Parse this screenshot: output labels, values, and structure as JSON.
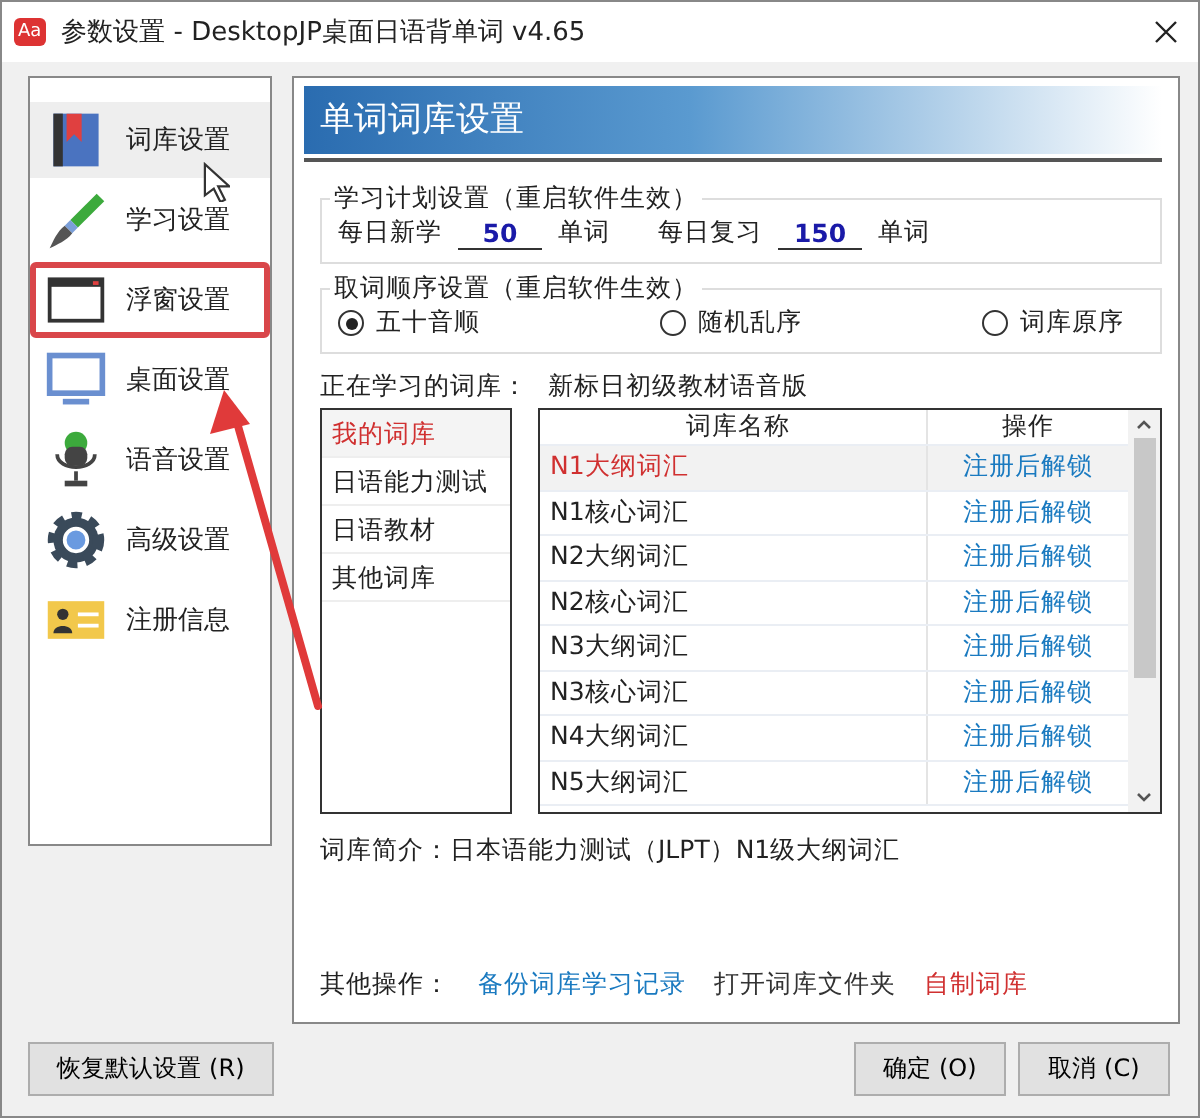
{
  "window": {
    "title": "参数设置 - DesktopJP桌面日语背单词 v4.65",
    "app_icon": "Aa"
  },
  "sidebar": {
    "items": [
      {
        "label": "词库设置",
        "selected": true,
        "highlighted": false
      },
      {
        "label": "学习设置",
        "selected": false,
        "highlighted": false
      },
      {
        "label": "浮窗设置",
        "selected": false,
        "highlighted": true
      },
      {
        "label": "桌面设置",
        "selected": false,
        "highlighted": false
      },
      {
        "label": "语音设置",
        "selected": false,
        "highlighted": false
      },
      {
        "label": "高级设置",
        "selected": false,
        "highlighted": false
      },
      {
        "label": "注册信息",
        "selected": false,
        "highlighted": false
      }
    ]
  },
  "panel": {
    "title": "单词词库设置",
    "plan": {
      "legend": "学习计划设置（重启软件生效）",
      "new_label": "每日新学",
      "new_value": "50",
      "new_unit": "单词",
      "review_label": "每日复习",
      "review_value": "150",
      "review_unit": "单词"
    },
    "order": {
      "legend": "取词顺序设置（重启软件生效）",
      "options": [
        {
          "label": "五十音顺",
          "selected": true
        },
        {
          "label": "随机乱序",
          "selected": false
        },
        {
          "label": "词库原序",
          "selected": false
        }
      ]
    },
    "current_label": "正在学习的词库：",
    "current_value": "新标日初级教材语音版",
    "categories": [
      {
        "label": "我的词库",
        "selected": true
      },
      {
        "label": "日语能力测试",
        "selected": false
      },
      {
        "label": "日语教材",
        "selected": false
      },
      {
        "label": "其他词库",
        "selected": false
      }
    ],
    "table": {
      "columns": [
        "词库名称",
        "操作"
      ],
      "rows": [
        {
          "name": "N1大纲词汇",
          "action": "注册后解锁",
          "selected": true
        },
        {
          "name": "N1核心词汇",
          "action": "注册后解锁",
          "selected": false
        },
        {
          "name": "N2大纲词汇",
          "action": "注册后解锁",
          "selected": false
        },
        {
          "name": "N2核心词汇",
          "action": "注册后解锁",
          "selected": false
        },
        {
          "name": "N3大纲词汇",
          "action": "注册后解锁",
          "selected": false
        },
        {
          "name": "N3核心词汇",
          "action": "注册后解锁",
          "selected": false
        },
        {
          "name": "N4大纲词汇",
          "action": "注册后解锁",
          "selected": false
        },
        {
          "name": "N5大纲词汇",
          "action": "注册后解锁",
          "selected": false
        }
      ]
    },
    "intro": "词库简介：日本语能力测试（JLPT）N1级大纲词汇",
    "other_label": "其他操作：",
    "links": [
      {
        "label": "备份词库学习记录",
        "kind": "blue"
      },
      {
        "label": "打开词库文件夹",
        "kind": "plain"
      },
      {
        "label": "自制词库",
        "kind": "red"
      }
    ]
  },
  "buttons": {
    "reset": "恢复默认设置 (R)",
    "ok": "确定 (O)",
    "cancel": "取消 (C)"
  },
  "pointer_arrow": true
}
